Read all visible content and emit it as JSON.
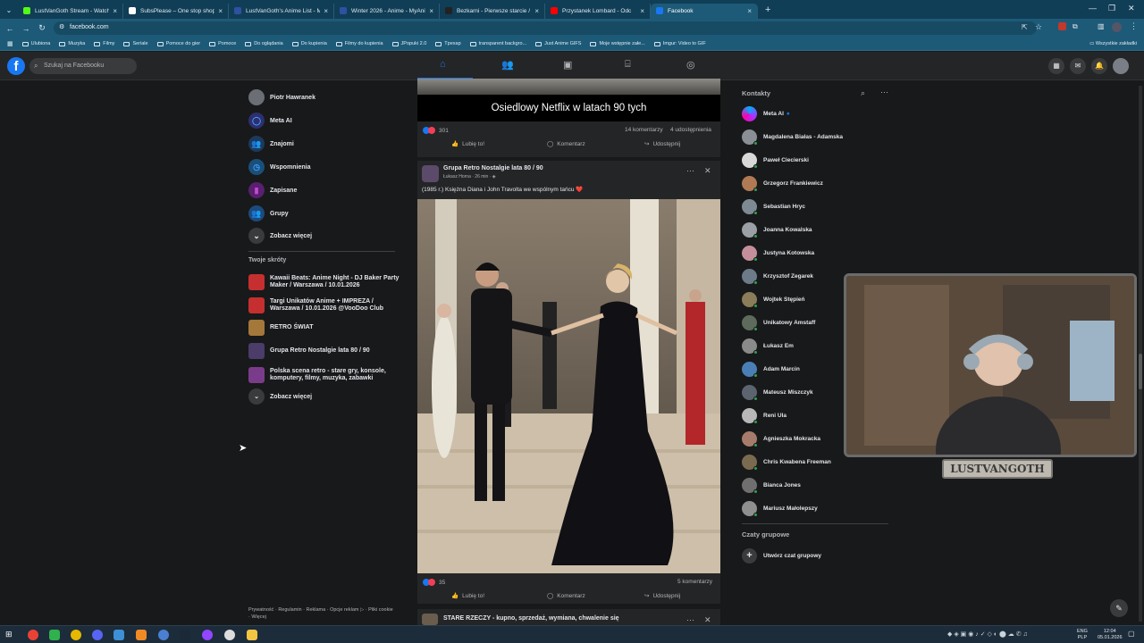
{
  "browser": {
    "tabs": [
      {
        "title": "LustVanGoth Stream - Watch Li",
        "color": "#53fc18"
      },
      {
        "title": "SubsPlease – One stop shop fo",
        "color": "#ffffff"
      },
      {
        "title": "LustVanGoth's Anime List - My",
        "color": "#2e51a2"
      },
      {
        "title": "Winter 2026 - Anime - MyAnim",
        "color": "#2e51a2"
      },
      {
        "title": "Bezkarni - Pierwsze starcie / Th",
        "color": "#222222"
      },
      {
        "title": "Przystanek Lombard - Odc",
        "color": "#ff0000"
      },
      {
        "title": "Facebook",
        "color": "#1877f2"
      }
    ],
    "url": "facebook.com",
    "bookmarks": [
      "Ulubiona",
      "Muzyka",
      "Filmy",
      "Seriale",
      "Pomoce do gier",
      "Pomoce",
      "Do oglądania",
      "Do kupienia",
      "Filmy do kupienia",
      "JPopuki 2.0",
      "Tpexap",
      "transparent backgro...",
      "Just Anime GIFS",
      "Moje wstępnie załe...",
      "Imgur: Video to GIF"
    ],
    "all_bookmarks": "Wszystkie zakładki"
  },
  "fb": {
    "search_placeholder": "Szukaj na Facebooku",
    "left_nav": [
      {
        "label": "Piotr Hawranek",
        "icon": "profile-avatar"
      },
      {
        "label": "Meta AI",
        "icon": "meta-ai-icon"
      },
      {
        "label": "Znajomi",
        "icon": "friends-icon"
      },
      {
        "label": "Wspomnienia",
        "icon": "memories-icon"
      },
      {
        "label": "Zapisane",
        "icon": "saved-icon"
      },
      {
        "label": "Grupy",
        "icon": "groups-icon"
      },
      {
        "label": "Zobacz więcej",
        "icon": "chevron-down-icon"
      }
    ],
    "shortcuts_title": "Twoje skróty",
    "shortcuts": [
      {
        "line1": "Kawaii Beats: Anime Night - DJ Baker Party",
        "line2": "Maker / Warszawa / 10.01.2026"
      },
      {
        "line1": "Targi Unikatów Anime + IMPREZA /",
        "line2": "Warszawa / 10.01.2026 @VooDoo Club"
      },
      {
        "line1": "RETRO ŚWIAT",
        "line2": ""
      },
      {
        "line1": "Grupa Retro Nostalgie lata 80 / 90",
        "line2": ""
      },
      {
        "line1": "Polska scena retro - stare gry, konsole,",
        "line2": "komputery, filmy, muzyka, zabawki"
      }
    ],
    "shortcuts_more": "Zobacz więcej",
    "footer_links": "Prywatność · Regulamin · Reklama · Opcje reklam ▷ · Pliki cookie · Więcej",
    "posts": [
      {
        "image_caption": "Osiedlowy Netflix w latach 90 tych",
        "reactions": "301",
        "comments": "14 komentarzy",
        "shares": "4 udostępnienia",
        "like": "Lubię to!",
        "comment": "Komentarz",
        "share": "Udostępnij"
      },
      {
        "group": "Grupa Retro Nostalgie lata 80 / 90",
        "author_time": "Łukasz Horna · 26 min · ◈",
        "text": "(1985 r.) Księżna Diana i John Travolta we wspólnym tańcu ❤️",
        "reactions": "35",
        "comments": "5 komentarzy",
        "like": "Lubię to!",
        "comment": "Komentarz",
        "share": "Udostępnij"
      },
      {
        "group": "STARE RZECZY - kupno, sprzedaż, wymiana, chwalenie się"
      }
    ],
    "contacts_title": "Kontakty",
    "contacts": [
      {
        "name": "Meta AI",
        "color": "#6e3ff3",
        "online": false
      },
      {
        "name": "Magdalena Białas - Adamska",
        "color": "#8a8f96",
        "online": true
      },
      {
        "name": "Paweł Ciecierski",
        "color": "#d8d8d8",
        "online": true
      },
      {
        "name": "Grzegorz Frankiewicz",
        "color": "#b07a55",
        "online": true
      },
      {
        "name": "Sebastian Hryc",
        "color": "#7d8a94",
        "online": true
      },
      {
        "name": "Joanna Kowalska",
        "color": "#9aa0a6",
        "online": true
      },
      {
        "name": "Justyna Kotowska",
        "color": "#c48f9b",
        "online": true
      },
      {
        "name": "Krzysztof Zegarek",
        "color": "#6d7a88",
        "online": true
      },
      {
        "name": "Wojtek Stępień",
        "color": "#8b7d5a",
        "online": true
      },
      {
        "name": "Unikatowy Amstaff",
        "color": "#5e6b5c",
        "online": true
      },
      {
        "name": "Łukasz Em",
        "color": "#8a8a8a",
        "online": true
      },
      {
        "name": "Adam Marcin",
        "color": "#4a7fb5",
        "online": true
      },
      {
        "name": "Mateusz Miszczyk",
        "color": "#5c6470",
        "online": true
      },
      {
        "name": "Reni Ula",
        "color": "#b8b8b8",
        "online": true
      },
      {
        "name": "Agnieszka Mokracka",
        "color": "#a57c6b",
        "online": true
      },
      {
        "name": "Chris Kwabena Freeman",
        "color": "#7a6a50",
        "online": true
      },
      {
        "name": "Bianca Jones",
        "color": "#6f6f6f",
        "online": true
      },
      {
        "name": "Mariusz Małolepszy",
        "color": "#8f8f8f",
        "online": true
      }
    ],
    "group_chats_title": "Czaty grupowe",
    "create_group_chat": "Utwórz czat grupowy"
  },
  "overlay": {
    "streamer_name": "LUSTVANGOTH"
  },
  "taskbar": {
    "lang": "ENG",
    "layout": "PLP",
    "time": "12:04",
    "date": "05.01.2026"
  }
}
